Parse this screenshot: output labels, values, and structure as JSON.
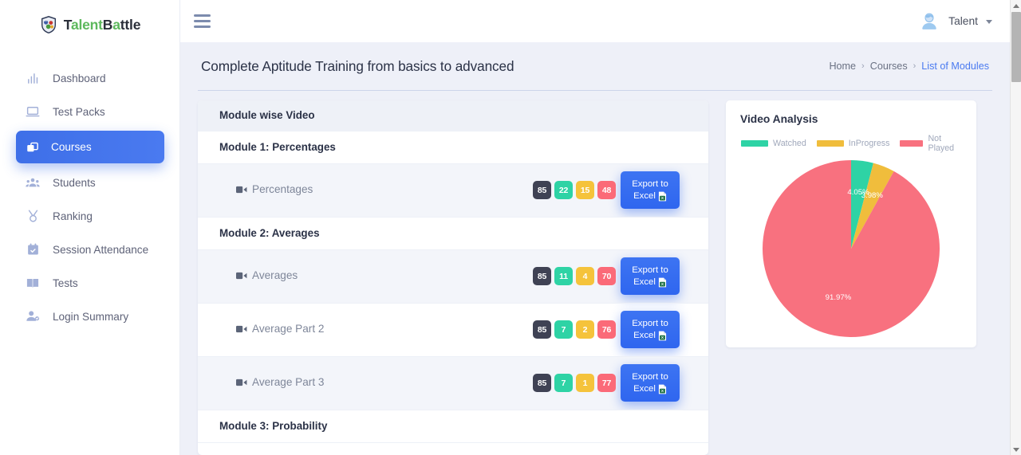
{
  "brand": {
    "text_parts": [
      {
        "t": "T",
        "c": "dk"
      },
      {
        "t": "alent",
        "c": "gr"
      },
      {
        "t": "B",
        "c": "dk"
      },
      {
        "t": "a",
        "c": "gr"
      },
      {
        "t": "ttle",
        "c": "dk"
      }
    ],
    "full_text": "TalentBattle",
    "logo_icon": "shield-logo-icon"
  },
  "sidebar": {
    "items": [
      {
        "label": "Dashboard",
        "icon": "bar-chart-icon",
        "active": false
      },
      {
        "label": "Test Packs",
        "icon": "laptop-icon",
        "active": false
      },
      {
        "label": "Courses",
        "icon": "layers-copy-icon",
        "active": true
      },
      {
        "label": "Students",
        "icon": "users-group-icon",
        "active": false
      },
      {
        "label": "Ranking",
        "icon": "medal-icon",
        "active": false
      },
      {
        "label": "Session Attendance",
        "icon": "calendar-check-icon",
        "active": false
      },
      {
        "label": "Tests",
        "icon": "book-open-icon",
        "active": false
      },
      {
        "label": "Login Summary",
        "icon": "user-check-icon",
        "active": false
      }
    ]
  },
  "topbar": {
    "menu_icon": "hamburger-menu-icon",
    "user_name": "Talent",
    "avatar_icon": "user-avatar-icon",
    "caret_icon": "chevron-down-icon"
  },
  "page": {
    "title": "Complete Aptitude Training from basics to advanced",
    "breadcrumb": [
      {
        "label": "Home",
        "current": false
      },
      {
        "label": "Courses",
        "current": false
      },
      {
        "label": "List of Modules",
        "current": true
      }
    ],
    "breadcrumb_separator": "›"
  },
  "table": {
    "header": "Module wise Video",
    "video_icon": "video-camera-icon",
    "export_button": {
      "line1": "Export to",
      "line2": "Excel",
      "icon": "excel-file-icon"
    },
    "rows": [
      {
        "type": "module",
        "label": "Module 1: Percentages"
      },
      {
        "type": "video",
        "label": "Percentages",
        "badges": [
          {
            "value": "85",
            "color": "dark"
          },
          {
            "value": "22",
            "color": "green"
          },
          {
            "value": "15",
            "color": "amber"
          },
          {
            "value": "48",
            "color": "pink"
          }
        ],
        "badge_wrap": true,
        "alt": true
      },
      {
        "type": "module",
        "label": "Module 2: Averages"
      },
      {
        "type": "video",
        "label": "Averages",
        "badges": [
          {
            "value": "85",
            "color": "dark"
          },
          {
            "value": "11",
            "color": "green"
          },
          {
            "value": "4",
            "color": "amber"
          },
          {
            "value": "70",
            "color": "pink"
          }
        ],
        "badge_wrap": false,
        "alt": true
      },
      {
        "type": "video",
        "label": "Average Part 2",
        "badges": [
          {
            "value": "85",
            "color": "dark"
          },
          {
            "value": "7",
            "color": "green"
          },
          {
            "value": "2",
            "color": "amber"
          },
          {
            "value": "76",
            "color": "pink"
          }
        ],
        "badge_wrap": false,
        "alt": false
      },
      {
        "type": "video",
        "label": "Average Part 3",
        "badges": [
          {
            "value": "85",
            "color": "dark"
          },
          {
            "value": "7",
            "color": "green"
          },
          {
            "value": "1",
            "color": "amber"
          },
          {
            "value": "77",
            "color": "pink"
          }
        ],
        "badge_wrap": false,
        "alt": true
      },
      {
        "type": "module",
        "label": "Module 3: Probability"
      }
    ]
  },
  "chart_data": {
    "type": "pie",
    "title": "Video Analysis",
    "labels": [
      "Watched",
      "InProgress",
      "Not Played"
    ],
    "values": [
      4.05,
      3.98,
      91.97
    ],
    "value_labels": [
      "4.05%",
      "3.98%",
      "91.97%"
    ],
    "colors": [
      "#2ed3a5",
      "#f0bd3c",
      "#f8717f"
    ],
    "legend_position": "top",
    "unit": "%"
  },
  "colors": {
    "accent_blue": "#3e6fe8",
    "badge_dark": "#3f4254",
    "badge_green": "#2ed3a5",
    "badge_amber": "#f5c33b",
    "badge_pink": "#fb6a78",
    "page_bg": "#eef0f8",
    "brand_green": "#5cb85c"
  },
  "scrollbar": {
    "name": "vertical-scrollbar"
  }
}
